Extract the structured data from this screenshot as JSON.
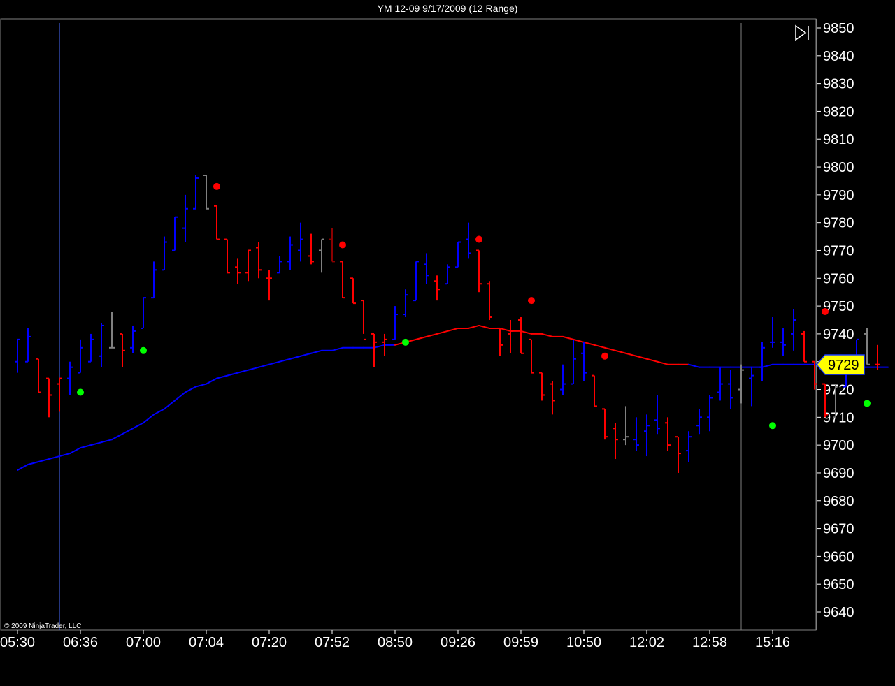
{
  "window": {
    "title": "YM 12-09  9/17/2009 (12 Range)"
  },
  "copyright": "© 2009 NinjaTrader, LLC",
  "current_price_label": "9729",
  "colors": {
    "background": "#000000",
    "up_bar": "#0000ff",
    "down_bar": "#ff0000",
    "neutral_bar": "#808080",
    "ma_up": "#0000ff",
    "ma_down": "#ff0000",
    "dot_buy": "#00ff00",
    "dot_sell": "#ff0000",
    "price_marker": "#ffff00"
  },
  "icons": {
    "scroll_end": "scroll-to-end-icon"
  },
  "chart_data": {
    "type": "ohlc",
    "title": "YM 12-09  9/17/2009 (12 Range)",
    "ylim": [
      9635,
      9852
    ],
    "y_ticks": [
      9850,
      9840,
      9830,
      9820,
      9810,
      9800,
      9790,
      9780,
      9770,
      9760,
      9750,
      9740,
      9730,
      9720,
      9710,
      9700,
      9690,
      9680,
      9670,
      9660,
      9650,
      9640
    ],
    "x_tick_labels": [
      "05:30",
      "06:36",
      "07:00",
      "07:04",
      "07:20",
      "07:52",
      "08:50",
      "09:26",
      "09:59",
      "10:50",
      "12:02",
      "12:58",
      "15:16"
    ],
    "bars": [
      {
        "o": 9730,
        "h": 9738,
        "l": 9726,
        "c": 9738,
        "color": "up"
      },
      {
        "o": 9730,
        "h": 9742,
        "l": 9730,
        "c": 9739,
        "color": "up"
      },
      {
        "o": 9731,
        "h": 9731,
        "l": 9719,
        "c": 9719,
        "color": "down"
      },
      {
        "o": 9724,
        "h": 9724,
        "l": 9710,
        "c": 9718,
        "color": "down"
      },
      {
        "o": 9722,
        "h": 9724,
        "l": 9712,
        "c": 9724,
        "color": "down"
      },
      {
        "o": 9724,
        "h": 9730,
        "l": 9718,
        "c": 9728,
        "color": "up"
      },
      {
        "o": 9726,
        "h": 9738,
        "l": 9726,
        "c": 9735,
        "color": "up"
      },
      {
        "o": 9730,
        "h": 9740,
        "l": 9730,
        "c": 9738,
        "color": "up"
      },
      {
        "o": 9732,
        "h": 9744,
        "l": 9728,
        "c": 9743,
        "color": "up"
      },
      {
        "o": 9735,
        "h": 9748,
        "l": 9735,
        "c": 9735,
        "color": "neutral"
      },
      {
        "o": 9740,
        "h": 9740,
        "l": 9728,
        "c": 9734,
        "color": "down"
      },
      {
        "o": 9735,
        "h": 9743,
        "l": 9733,
        "c": 9741,
        "color": "up"
      },
      {
        "o": 9742,
        "h": 9753,
        "l": 9742,
        "c": 9753,
        "color": "up"
      },
      {
        "o": 9753,
        "h": 9766,
        "l": 9753,
        "c": 9763,
        "color": "up"
      },
      {
        "o": 9763,
        "h": 9775,
        "l": 9763,
        "c": 9773,
        "color": "up"
      },
      {
        "o": 9770,
        "h": 9782,
        "l": 9770,
        "c": 9782,
        "color": "up"
      },
      {
        "o": 9778,
        "h": 9790,
        "l": 9773,
        "c": 9785,
        "color": "up"
      },
      {
        "o": 9785,
        "h": 9797,
        "l": 9785,
        "c": 9796,
        "color": "up"
      },
      {
        "o": 9797,
        "h": 9797,
        "l": 9785,
        "c": 9785,
        "color": "neutral"
      },
      {
        "o": 9786,
        "h": 9786,
        "l": 9774,
        "c": 9774,
        "color": "down"
      },
      {
        "o": 9774,
        "h": 9774,
        "l": 9762,
        "c": 9762,
        "color": "down"
      },
      {
        "o": 9764,
        "h": 9767,
        "l": 9758,
        "c": 9762,
        "color": "down"
      },
      {
        "o": 9762,
        "h": 9770,
        "l": 9759,
        "c": 9770,
        "color": "red-up"
      },
      {
        "o": 9771,
        "h": 9773,
        "l": 9760,
        "c": 9763,
        "color": "down"
      },
      {
        "o": 9760,
        "h": 9763,
        "l": 9752,
        "c": 9760,
        "color": "down"
      },
      {
        "o": 9762,
        "h": 9768,
        "l": 9762,
        "c": 9766,
        "color": "up"
      },
      {
        "o": 9766,
        "h": 9775,
        "l": 9763,
        "c": 9772,
        "color": "up"
      },
      {
        "o": 9770,
        "h": 9780,
        "l": 9766,
        "c": 9774,
        "color": "up"
      },
      {
        "o": 9768,
        "h": 9776,
        "l": 9765,
        "c": 9766,
        "color": "down"
      },
      {
        "o": 9770,
        "h": 9774,
        "l": 9762,
        "c": 9774,
        "color": "neutral"
      },
      {
        "o": 9774,
        "h": 9778,
        "l": 9766,
        "c": 9766,
        "color": "dark-red"
      },
      {
        "o": 9766,
        "h": 9766,
        "l": 9753,
        "c": 9753,
        "color": "down"
      },
      {
        "o": 9760,
        "h": 9760,
        "l": 9751,
        "c": 9751,
        "color": "down"
      },
      {
        "o": 9752,
        "h": 9752,
        "l": 9740,
        "c": 9738,
        "color": "down"
      },
      {
        "o": 9740,
        "h": 9740,
        "l": 9728,
        "c": 9737,
        "color": "down"
      },
      {
        "o": 9737,
        "h": 9740,
        "l": 9732,
        "c": 9738,
        "color": "red-up"
      },
      {
        "o": 9738,
        "h": 9750,
        "l": 9738,
        "c": 9747,
        "color": "up"
      },
      {
        "o": 9747,
        "h": 9756,
        "l": 9746,
        "c": 9754,
        "color": "up"
      },
      {
        "o": 9752,
        "h": 9766,
        "l": 9752,
        "c": 9766,
        "color": "up"
      },
      {
        "o": 9765,
        "h": 9769,
        "l": 9758,
        "c": 9761,
        "color": "up"
      },
      {
        "o": 9759,
        "h": 9761,
        "l": 9752,
        "c": 9756,
        "color": "down"
      },
      {
        "o": 9758,
        "h": 9765,
        "l": 9758,
        "c": 9764,
        "color": "up"
      },
      {
        "o": 9764,
        "h": 9773,
        "l": 9764,
        "c": 9773,
        "color": "up"
      },
      {
        "o": 9774,
        "h": 9780,
        "l": 9767,
        "c": 9769,
        "color": "up"
      },
      {
        "o": 9770,
        "h": 9770,
        "l": 9755,
        "c": 9758,
        "color": "down"
      },
      {
        "o": 9758,
        "h": 9759,
        "l": 9745,
        "c": 9746,
        "color": "down"
      },
      {
        "o": 9742,
        "h": 9742,
        "l": 9732,
        "c": 9736,
        "color": "down"
      },
      {
        "o": 9740,
        "h": 9745,
        "l": 9733,
        "c": 9741,
        "color": "down"
      },
      {
        "o": 9745,
        "h": 9746,
        "l": 9733,
        "c": 9733,
        "color": "down"
      },
      {
        "o": 9738,
        "h": 9738,
        "l": 9726,
        "c": 9726,
        "color": "down"
      },
      {
        "o": 9726,
        "h": 9726,
        "l": 9716,
        "c": 9718,
        "color": "down"
      },
      {
        "o": 9722,
        "h": 9723,
        "l": 9711,
        "c": 9716,
        "color": "down"
      },
      {
        "o": 9720,
        "h": 9729,
        "l": 9718,
        "c": 9722,
        "color": "up"
      },
      {
        "o": 9722,
        "h": 9738,
        "l": 9722,
        "c": 9731,
        "color": "up"
      },
      {
        "o": 9733,
        "h": 9737,
        "l": 9723,
        "c": 9726,
        "color": "up"
      },
      {
        "o": 9725,
        "h": 9725,
        "l": 9714,
        "c": 9714,
        "color": "down"
      },
      {
        "o": 9713,
        "h": 9713,
        "l": 9702,
        "c": 9703,
        "color": "down"
      },
      {
        "o": 9706,
        "h": 9708,
        "l": 9695,
        "c": 9702,
        "color": "down"
      },
      {
        "o": 9702,
        "h": 9714,
        "l": 9700,
        "c": 9703,
        "color": "neutral"
      },
      {
        "o": 9702,
        "h": 9710,
        "l": 9698,
        "c": 9700,
        "color": "up"
      },
      {
        "o": 9705,
        "h": 9711,
        "l": 9696,
        "c": 9707,
        "color": "up"
      },
      {
        "o": 9709,
        "h": 9718,
        "l": 9704,
        "c": 9706,
        "color": "up"
      },
      {
        "o": 9708,
        "h": 9710,
        "l": 9698,
        "c": 9700,
        "color": "down"
      },
      {
        "o": 9703,
        "h": 9703,
        "l": 9690,
        "c": 9697,
        "color": "down"
      },
      {
        "o": 9698,
        "h": 9705,
        "l": 9694,
        "c": 9703,
        "color": "up"
      },
      {
        "o": 9707,
        "h": 9713,
        "l": 9704,
        "c": 9710,
        "color": "up"
      },
      {
        "o": 9710,
        "h": 9718,
        "l": 9705,
        "c": 9717,
        "color": "up"
      },
      {
        "o": 9719,
        "h": 9728,
        "l": 9716,
        "c": 9722,
        "color": "up"
      },
      {
        "o": 9722,
        "h": 9727,
        "l": 9713,
        "c": 9717,
        "color": "up"
      },
      {
        "o": 9720,
        "h": 9729,
        "l": 9715,
        "c": 9727,
        "color": "neutral"
      },
      {
        "o": 9724,
        "h": 9728,
        "l": 9714,
        "c": 9725,
        "color": "up"
      },
      {
        "o": 9728,
        "h": 9737,
        "l": 9723,
        "c": 9735,
        "color": "up"
      },
      {
        "o": 9737,
        "h": 9746,
        "l": 9735,
        "c": 9737,
        "color": "up"
      },
      {
        "o": 9737,
        "h": 9742,
        "l": 9732,
        "c": 9736,
        "color": "up"
      },
      {
        "o": 9740,
        "h": 9749,
        "l": 9734,
        "c": 9745,
        "color": "up"
      },
      {
        "o": 9740,
        "h": 9741,
        "l": 9730,
        "c": 9730,
        "color": "down"
      },
      {
        "o": 9730,
        "h": 9730,
        "l": 9720,
        "c": 9722,
        "color": "down"
      },
      {
        "o": 9722,
        "h": 9722,
        "l": 9710,
        "c": 9711,
        "color": "down"
      },
      {
        "o": 9710,
        "h": 9722,
        "l": 9710,
        "c": 9721,
        "color": "neutral"
      },
      {
        "o": 9721,
        "h": 9732,
        "l": 9721,
        "c": 9728,
        "color": "up"
      },
      {
        "o": 9729,
        "h": 9738,
        "l": 9728,
        "c": 9738,
        "color": "up"
      },
      {
        "o": 9740,
        "h": 9742,
        "l": 9729,
        "c": 9729,
        "color": "neutral"
      },
      {
        "o": 9729,
        "h": 9736,
        "l": 9727,
        "c": 9729,
        "color": "down"
      }
    ],
    "moving_average": [
      9691,
      9693,
      9694,
      9695,
      9696,
      9697,
      9699,
      9700,
      9701,
      9702,
      9704,
      9706,
      9708,
      9711,
      9713,
      9716,
      9719,
      9721,
      9722,
      9724,
      9725,
      9726,
      9727,
      9728,
      9729,
      9730,
      9731,
      9732,
      9733,
      9734,
      9734,
      9735,
      9735,
      9735,
      9735,
      9736,
      9736,
      9737,
      9738,
      9739,
      9740,
      9741,
      9742,
      9742,
      9743,
      9742,
      9742,
      9741,
      9741,
      9740,
      9740,
      9739,
      9739,
      9738,
      9737,
      9736,
      9735,
      9734,
      9733,
      9732,
      9731,
      9730,
      9729,
      9729,
      9729,
      9728,
      9728,
      9728,
      9728,
      9728,
      9728,
      9728,
      9729,
      9729,
      9729,
      9729,
      9729,
      9729,
      9728,
      9728,
      9728,
      9728,
      9728,
      9728
    ],
    "sell_dots": [
      {
        "bar": 19,
        "y": 9793
      },
      {
        "bar": 31,
        "y": 9772
      },
      {
        "bar": 44,
        "y": 9774
      },
      {
        "bar": 49,
        "y": 9752
      },
      {
        "bar": 56,
        "y": 9732
      },
      {
        "bar": 77,
        "y": 9748
      }
    ],
    "buy_dots": [
      {
        "bar": 6,
        "y": 9719
      },
      {
        "bar": 12,
        "y": 9734
      },
      {
        "bar": 37,
        "y": 9737
      },
      {
        "bar": 72,
        "y": 9707
      },
      {
        "bar": 81,
        "y": 9715
      }
    ]
  }
}
